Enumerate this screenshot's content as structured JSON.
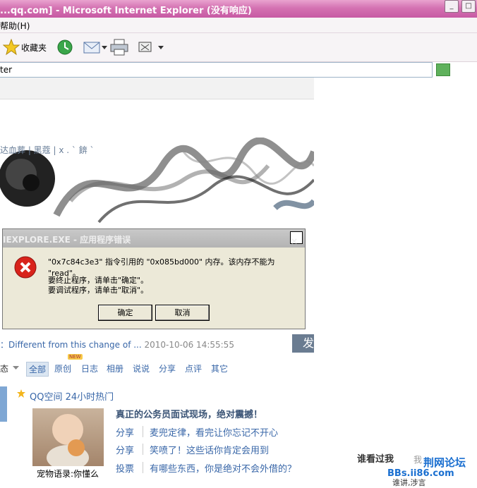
{
  "window": {
    "title": "...qq.com] - Microsoft Internet Explorer (没有响应)",
    "minimize_glyph": "_",
    "restore_glyph": "□"
  },
  "menu": {
    "help": "帮助(H)"
  },
  "toolbar": {
    "favorites_label": "收藏夹"
  },
  "address": {
    "value": "ter"
  },
  "blog": {
    "title_fragment": "达血葬 | 黑蔻 | x . ` 餴 ` "
  },
  "dialog": {
    "title": "IEXPLORE.EXE - 应用程序错误",
    "close_glyph": "×",
    "message_line1": "\"0x7c84c3e3\" 指令引用的 \"0x085bd000\" 内存。该内存不能为 \"read\"。",
    "message_line2": "要终止程序，请单击\"确定\"。",
    "message_line3": "要调试程序，请单击\"取消\"。",
    "ok_label": "确定",
    "cancel_label": "取消"
  },
  "post": {
    "prefix": "：",
    "title": "Different from this change of ...",
    "date": "2010-10-06 14:55:55",
    "publish_fragment": "发"
  },
  "feed_tabs": {
    "label_fragment": "态",
    "items": [
      "全部",
      "原创",
      "日志",
      "相册",
      "说说",
      "分享",
      "点评",
      "其它"
    ],
    "new_badge": "NEW"
  },
  "hot": {
    "title": "QQ空间 24小时热门",
    "pet_caption": "宠物语录:你懂么",
    "headline": "真正的公务员面试现场，绝对震撼！",
    "rows": [
      {
        "label": "分享",
        "text": "麦兜定律，看完让你忘记不开心"
      },
      {
        "label": "分享",
        "text": "笑喷了！这些话你肯定会用到"
      },
      {
        "label": "投票",
        "text": "有哪些东西，你是绝对不会外借的？"
      }
    ]
  },
  "sidebar_fragment": {
    "who_visited": "谁看过我",
    "more": "我"
  },
  "watermark": {
    "line1": "荆网论坛",
    "line2": "BBs.ii86.com"
  },
  "bottom_fragment": "谁讲,涉言"
}
